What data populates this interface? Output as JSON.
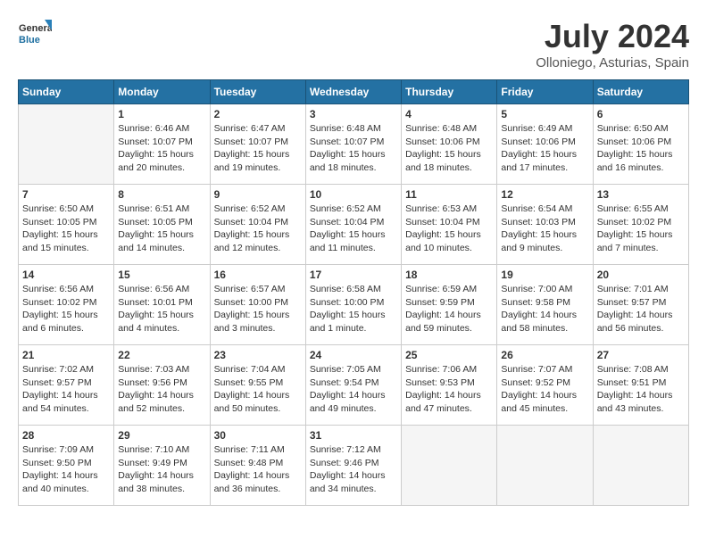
{
  "header": {
    "logo_general": "General",
    "logo_blue": "Blue",
    "month_title": "July 2024",
    "location": "Olloniego, Asturias, Spain"
  },
  "weekdays": [
    "Sunday",
    "Monday",
    "Tuesday",
    "Wednesday",
    "Thursday",
    "Friday",
    "Saturday"
  ],
  "weeks": [
    [
      {
        "day": "",
        "empty": true
      },
      {
        "day": "1",
        "sunrise": "6:46 AM",
        "sunset": "10:07 PM",
        "daylight": "15 hours and 20 minutes."
      },
      {
        "day": "2",
        "sunrise": "6:47 AM",
        "sunset": "10:07 PM",
        "daylight": "15 hours and 19 minutes."
      },
      {
        "day": "3",
        "sunrise": "6:48 AM",
        "sunset": "10:07 PM",
        "daylight": "15 hours and 18 minutes."
      },
      {
        "day": "4",
        "sunrise": "6:48 AM",
        "sunset": "10:06 PM",
        "daylight": "15 hours and 18 minutes."
      },
      {
        "day": "5",
        "sunrise": "6:49 AM",
        "sunset": "10:06 PM",
        "daylight": "15 hours and 17 minutes."
      },
      {
        "day": "6",
        "sunrise": "6:50 AM",
        "sunset": "10:06 PM",
        "daylight": "15 hours and 16 minutes."
      }
    ],
    [
      {
        "day": "7",
        "sunrise": "6:50 AM",
        "sunset": "10:05 PM",
        "daylight": "15 hours and 15 minutes."
      },
      {
        "day": "8",
        "sunrise": "6:51 AM",
        "sunset": "10:05 PM",
        "daylight": "15 hours and 14 minutes."
      },
      {
        "day": "9",
        "sunrise": "6:52 AM",
        "sunset": "10:04 PM",
        "daylight": "15 hours and 12 minutes."
      },
      {
        "day": "10",
        "sunrise": "6:52 AM",
        "sunset": "10:04 PM",
        "daylight": "15 hours and 11 minutes."
      },
      {
        "day": "11",
        "sunrise": "6:53 AM",
        "sunset": "10:04 PM",
        "daylight": "15 hours and 10 minutes."
      },
      {
        "day": "12",
        "sunrise": "6:54 AM",
        "sunset": "10:03 PM",
        "daylight": "15 hours and 9 minutes."
      },
      {
        "day": "13",
        "sunrise": "6:55 AM",
        "sunset": "10:02 PM",
        "daylight": "15 hours and 7 minutes."
      }
    ],
    [
      {
        "day": "14",
        "sunrise": "6:56 AM",
        "sunset": "10:02 PM",
        "daylight": "15 hours and 6 minutes."
      },
      {
        "day": "15",
        "sunrise": "6:56 AM",
        "sunset": "10:01 PM",
        "daylight": "15 hours and 4 minutes."
      },
      {
        "day": "16",
        "sunrise": "6:57 AM",
        "sunset": "10:00 PM",
        "daylight": "15 hours and 3 minutes."
      },
      {
        "day": "17",
        "sunrise": "6:58 AM",
        "sunset": "10:00 PM",
        "daylight": "15 hours and 1 minute."
      },
      {
        "day": "18",
        "sunrise": "6:59 AM",
        "sunset": "9:59 PM",
        "daylight": "14 hours and 59 minutes."
      },
      {
        "day": "19",
        "sunrise": "7:00 AM",
        "sunset": "9:58 PM",
        "daylight": "14 hours and 58 minutes."
      },
      {
        "day": "20",
        "sunrise": "7:01 AM",
        "sunset": "9:57 PM",
        "daylight": "14 hours and 56 minutes."
      }
    ],
    [
      {
        "day": "21",
        "sunrise": "7:02 AM",
        "sunset": "9:57 PM",
        "daylight": "14 hours and 54 minutes."
      },
      {
        "day": "22",
        "sunrise": "7:03 AM",
        "sunset": "9:56 PM",
        "daylight": "14 hours and 52 minutes."
      },
      {
        "day": "23",
        "sunrise": "7:04 AM",
        "sunset": "9:55 PM",
        "daylight": "14 hours and 50 minutes."
      },
      {
        "day": "24",
        "sunrise": "7:05 AM",
        "sunset": "9:54 PM",
        "daylight": "14 hours and 49 minutes."
      },
      {
        "day": "25",
        "sunrise": "7:06 AM",
        "sunset": "9:53 PM",
        "daylight": "14 hours and 47 minutes."
      },
      {
        "day": "26",
        "sunrise": "7:07 AM",
        "sunset": "9:52 PM",
        "daylight": "14 hours and 45 minutes."
      },
      {
        "day": "27",
        "sunrise": "7:08 AM",
        "sunset": "9:51 PM",
        "daylight": "14 hours and 43 minutes."
      }
    ],
    [
      {
        "day": "28",
        "sunrise": "7:09 AM",
        "sunset": "9:50 PM",
        "daylight": "14 hours and 40 minutes."
      },
      {
        "day": "29",
        "sunrise": "7:10 AM",
        "sunset": "9:49 PM",
        "daylight": "14 hours and 38 minutes."
      },
      {
        "day": "30",
        "sunrise": "7:11 AM",
        "sunset": "9:48 PM",
        "daylight": "14 hours and 36 minutes."
      },
      {
        "day": "31",
        "sunrise": "7:12 AM",
        "sunset": "9:46 PM",
        "daylight": "14 hours and 34 minutes."
      },
      {
        "day": "",
        "empty": true
      },
      {
        "day": "",
        "empty": true
      },
      {
        "day": "",
        "empty": true
      }
    ]
  ]
}
